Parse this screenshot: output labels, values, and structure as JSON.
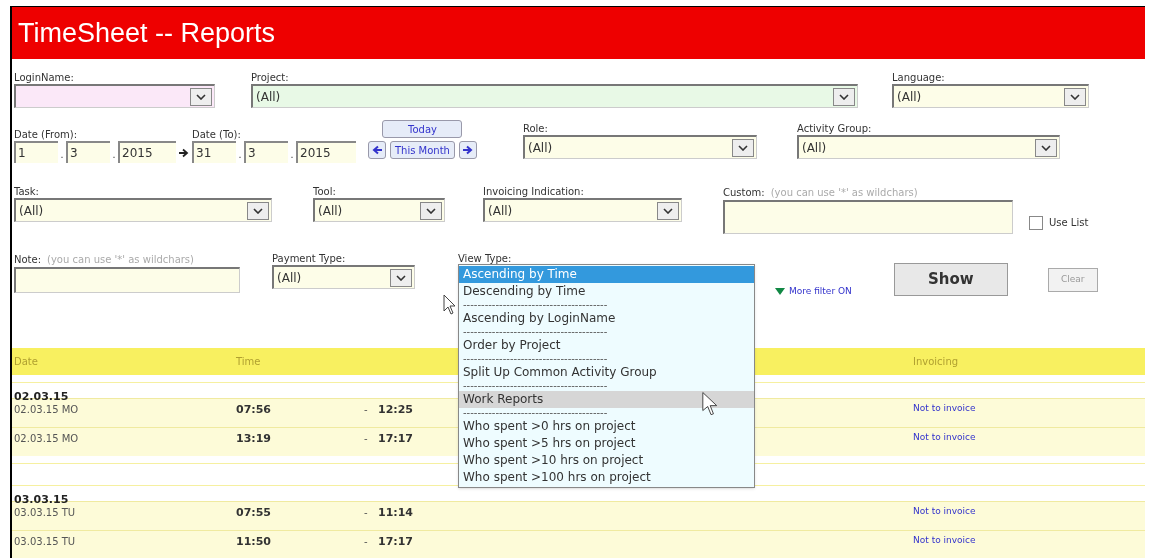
{
  "title": "TimeSheet -- Reports",
  "filters": [
    {
      "kind": "select",
      "label": "LoginName:",
      "color": "#fbe8f8"
    },
    {
      "kind": "select",
      "label": "Project:",
      "value": "(All)",
      "color": "#e8f9e6"
    },
    {
      "kind": "select",
      "label": "Language:",
      "value": "(All)",
      "color": "#fdfde8"
    }
  ],
  "date_from": {
    "label": "Date (From):",
    "day": "1",
    "dot_1": ".",
    "month": "3",
    "dot_2": ".",
    "year": "2015"
  },
  "date_to": {
    "label": "Date (To):",
    "day": "31",
    "dot_1": ".",
    "month": "3",
    "dot_2": ".",
    "year": "2015"
  },
  "today_button": "Today",
  "this_month_button": "This Month",
  "filters_2": [
    {
      "kind": "select",
      "label": "Role:",
      "value": "(All)",
      "color": "#fdfde8"
    },
    {
      "kind": "select",
      "label": "Activity Group:",
      "value": "(All)",
      "color": "#fdfde8"
    }
  ],
  "filters_3": [
    {
      "kind": "select",
      "label": "Task:",
      "value": "(All)",
      "color": "#fdfde8"
    },
    {
      "kind": "select",
      "label": "Tool:",
      "value": "(All)",
      "color": "#fdfde8"
    },
    {
      "kind": "select",
      "label": "Invoicing Indication:",
      "value": "(All)",
      "color": "#fdfde8"
    },
    {
      "kind": "text",
      "label": "Custom:",
      "hint": "(you can use '*' as wildchars)",
      "color": "#fdfde8"
    }
  ],
  "use_list": {
    "label": "Use List",
    "checked": false
  },
  "note": {
    "label": "Note:",
    "hint": "(you can use '*' as wildchars)"
  },
  "payment_type": {
    "label": "Payment Type:",
    "value": "(All)"
  },
  "view_type": {
    "label": "View Type:",
    "options": [
      {
        "kind": "option",
        "text": "Ascending by Time",
        "selected": true,
        "hovered": false
      },
      {
        "kind": "option",
        "text": "Descending by Time",
        "selected": false,
        "hovered": false
      },
      {
        "kind": "separator",
        "text": "----------------------------------------"
      },
      {
        "kind": "option",
        "text": "Ascending by LoginName",
        "selected": false,
        "hovered": false
      },
      {
        "kind": "separator",
        "text": "----------------------------------------"
      },
      {
        "kind": "option",
        "text": "Order by Project",
        "selected": false,
        "hovered": false
      },
      {
        "kind": "separator",
        "text": "----------------------------------------"
      },
      {
        "kind": "option",
        "text": "Split Up Common Activity Group",
        "selected": false,
        "hovered": false
      },
      {
        "kind": "separator",
        "text": "----------------------------------------"
      },
      {
        "kind": "option",
        "text": "Work Reports",
        "selected": false,
        "hovered": true
      },
      {
        "kind": "separator",
        "text": "----------------------------------------"
      },
      {
        "kind": "option",
        "text": "Who spent >0 hrs on project",
        "selected": false,
        "hovered": false
      },
      {
        "kind": "option",
        "text": "Who spent >5 hrs on project",
        "selected": false,
        "hovered": false
      },
      {
        "kind": "option",
        "text": "Who spent >10 hrs on project",
        "selected": false,
        "hovered": false
      },
      {
        "kind": "option",
        "text": "Who spent >100 hrs on project",
        "selected": false,
        "hovered": false
      }
    ]
  },
  "more_filter": "More filter ON",
  "show_button": "Show",
  "clear_button": "Clear",
  "table": {
    "columns": [
      "Date",
      "Time",
      "Invoicing"
    ],
    "groups": [
      {
        "date": "02.03.15",
        "rows": [
          {
            "date": "02.03.15 MO",
            "from": "07:56",
            "dash": "-",
            "to": "12:25",
            "invoicing": "Not to invoice"
          },
          {
            "date": "02.03.15 MO",
            "from": "13:19",
            "dash": "-",
            "to": "17:17",
            "invoicing": "Not to invoice"
          }
        ]
      },
      {
        "date": "03.03.15",
        "rows": [
          {
            "date": "03.03.15 TU",
            "from": "07:55",
            "dash": "-",
            "to": "11:14",
            "invoicing": "Not to invoice"
          },
          {
            "date": "03.03.15 TU",
            "from": "11:50",
            "dash": "-",
            "to": "17:17",
            "invoicing": "Not to invoice"
          }
        ]
      }
    ]
  }
}
